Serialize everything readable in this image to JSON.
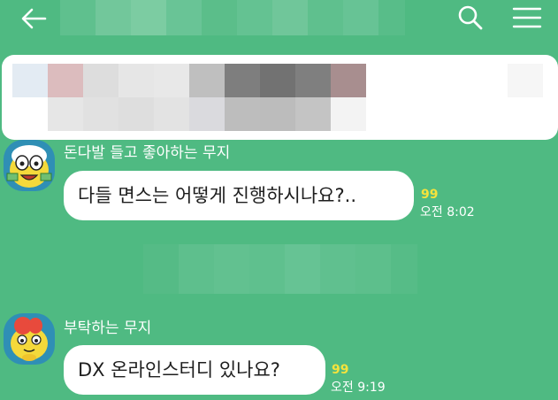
{
  "header": {
    "back_icon": "arrow-left-icon",
    "search_icon": "search-icon",
    "menu_icon": "hamburger-menu-icon"
  },
  "messages": [
    {
      "sender": "돈다발 들고 좋아하는 무지",
      "text": "다들 면스는 어떻게 진행하시나요?..",
      "unread": "99",
      "time": "오전 8:02"
    },
    {
      "sender": "부탁하는 무지",
      "text": "DX 온라인스터디 있나요?",
      "unread": "99",
      "time": "오전 9:19"
    }
  ],
  "colors": {
    "chat_background": "#4fba82",
    "bubble": "#ffffff",
    "unread_count": "#f5e33c"
  }
}
